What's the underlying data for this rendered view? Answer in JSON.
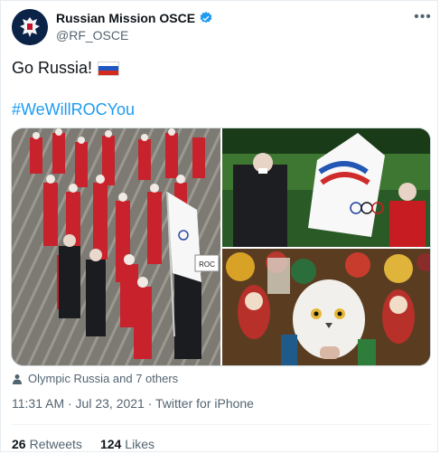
{
  "author": {
    "display_name": "Russian Mission OSCE",
    "handle": "@RF_OSCE"
  },
  "tweet": {
    "text": "Go Russia!",
    "hashtag": "#WeWillROCYou"
  },
  "media": {
    "sign_text": "ROC"
  },
  "tagged": "Olympic Russia and 7 others",
  "timestamp": "11:31 AM · Jul 23, 2021 · Twitter for iPhone",
  "stats": {
    "retweets_count": "26",
    "retweets_label": "Retweets",
    "likes_count": "124",
    "likes_label": "Likes"
  },
  "icons": {
    "verified": "verified-badge-icon",
    "more": "more-options-icon",
    "flag": "russia-flag-emoji",
    "tagged": "person-icon"
  },
  "colors": {
    "accent": "#1d9bf0",
    "text_primary": "#0f1419",
    "text_secondary": "#536471"
  }
}
